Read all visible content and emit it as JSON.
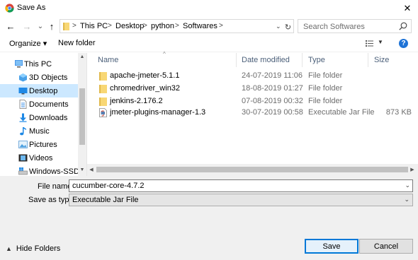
{
  "window": {
    "title": "Save As",
    "close_glyph": "✕"
  },
  "nav": {
    "back_glyph": "←",
    "forward_glyph": "→",
    "recent_glyph": "⌄",
    "up_glyph": "↑",
    "breadcrumbs": [
      "This PC",
      "Desktop",
      "python",
      "Softwares"
    ],
    "separator": ">",
    "search_placeholder": "Search Softwares"
  },
  "toolbar": {
    "organize_label": "Organize ▾",
    "new_folder_label": "New folder",
    "help_label": "?"
  },
  "tree": {
    "items": [
      {
        "label": "This PC",
        "icon": "pc-icon",
        "selected": false
      },
      {
        "label": "3D Objects",
        "icon": "cube-icon",
        "selected": false
      },
      {
        "label": "Desktop",
        "icon": "desktop-icon",
        "selected": true
      },
      {
        "label": "Documents",
        "icon": "documents-icon",
        "selected": false
      },
      {
        "label": "Downloads",
        "icon": "downloads-icon",
        "selected": false
      },
      {
        "label": "Music",
        "icon": "music-icon",
        "selected": false
      },
      {
        "label": "Pictures",
        "icon": "pictures-icon",
        "selected": false
      },
      {
        "label": "Videos",
        "icon": "videos-icon",
        "selected": false
      },
      {
        "label": "Windows-SSD (C",
        "icon": "drive-icon",
        "selected": false
      }
    ]
  },
  "columns": {
    "name": "Name",
    "date": "Date modified",
    "type": "Type",
    "size": "Size"
  },
  "files": [
    {
      "name": "apache-jmeter-5.1.1",
      "date": "24-07-2019 11:06",
      "type": "File folder",
      "size": "",
      "icon": "folder-icon"
    },
    {
      "name": "chromedriver_win32",
      "date": "18-08-2019 01:27",
      "type": "File folder",
      "size": "",
      "icon": "folder-icon"
    },
    {
      "name": "jenkins-2.176.2",
      "date": "07-08-2019 00:32",
      "type": "File folder",
      "size": "",
      "icon": "folder-icon"
    },
    {
      "name": "jmeter-plugins-manager-1.3",
      "date": "30-07-2019 00:58",
      "type": "Executable Jar File",
      "size": "873 KB",
      "icon": "jar-file-icon"
    }
  ],
  "form": {
    "file_name_label": "File name:",
    "file_name_value": "cucumber-core-4.7.2",
    "save_type_label": "Save as type:",
    "save_type_value": "Executable Jar File",
    "hide_folders_label": "Hide Folders",
    "save_label": "Save",
    "cancel_label": "Cancel"
  },
  "colors": {
    "selection": "#cce8ff",
    "folder": "#f8d775",
    "accent": "#0078d7"
  }
}
